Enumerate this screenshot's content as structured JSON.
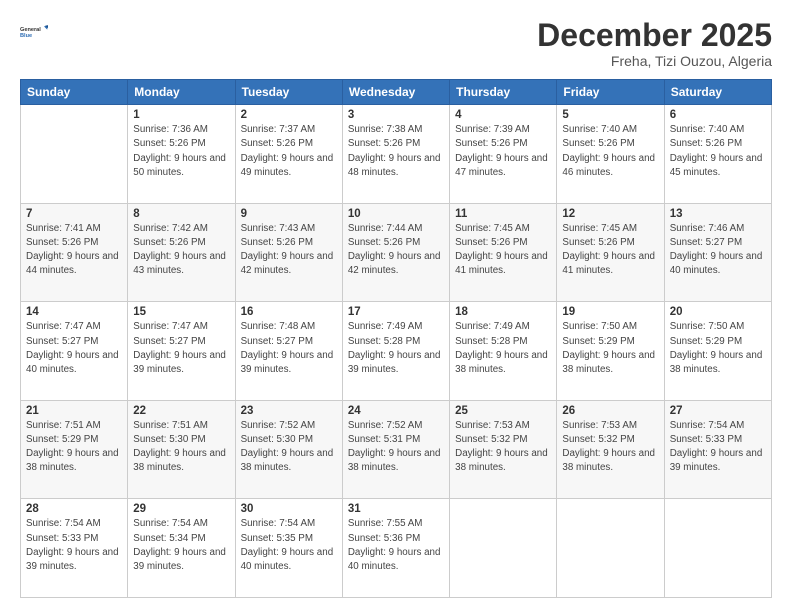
{
  "logo": {
    "line1": "General",
    "line2": "Blue"
  },
  "header": {
    "month": "December 2025",
    "location": "Freha, Tizi Ouzou, Algeria"
  },
  "weekdays": [
    "Sunday",
    "Monday",
    "Tuesday",
    "Wednesday",
    "Thursday",
    "Friday",
    "Saturday"
  ],
  "weeks": [
    [
      {
        "day": "",
        "sunrise": "",
        "sunset": "",
        "daylight": ""
      },
      {
        "day": "1",
        "sunrise": "Sunrise: 7:36 AM",
        "sunset": "Sunset: 5:26 PM",
        "daylight": "Daylight: 9 hours and 50 minutes."
      },
      {
        "day": "2",
        "sunrise": "Sunrise: 7:37 AM",
        "sunset": "Sunset: 5:26 PM",
        "daylight": "Daylight: 9 hours and 49 minutes."
      },
      {
        "day": "3",
        "sunrise": "Sunrise: 7:38 AM",
        "sunset": "Sunset: 5:26 PM",
        "daylight": "Daylight: 9 hours and 48 minutes."
      },
      {
        "day": "4",
        "sunrise": "Sunrise: 7:39 AM",
        "sunset": "Sunset: 5:26 PM",
        "daylight": "Daylight: 9 hours and 47 minutes."
      },
      {
        "day": "5",
        "sunrise": "Sunrise: 7:40 AM",
        "sunset": "Sunset: 5:26 PM",
        "daylight": "Daylight: 9 hours and 46 minutes."
      },
      {
        "day": "6",
        "sunrise": "Sunrise: 7:40 AM",
        "sunset": "Sunset: 5:26 PM",
        "daylight": "Daylight: 9 hours and 45 minutes."
      }
    ],
    [
      {
        "day": "7",
        "sunrise": "Sunrise: 7:41 AM",
        "sunset": "Sunset: 5:26 PM",
        "daylight": "Daylight: 9 hours and 44 minutes."
      },
      {
        "day": "8",
        "sunrise": "Sunrise: 7:42 AM",
        "sunset": "Sunset: 5:26 PM",
        "daylight": "Daylight: 9 hours and 43 minutes."
      },
      {
        "day": "9",
        "sunrise": "Sunrise: 7:43 AM",
        "sunset": "Sunset: 5:26 PM",
        "daylight": "Daylight: 9 hours and 42 minutes."
      },
      {
        "day": "10",
        "sunrise": "Sunrise: 7:44 AM",
        "sunset": "Sunset: 5:26 PM",
        "daylight": "Daylight: 9 hours and 42 minutes."
      },
      {
        "day": "11",
        "sunrise": "Sunrise: 7:45 AM",
        "sunset": "Sunset: 5:26 PM",
        "daylight": "Daylight: 9 hours and 41 minutes."
      },
      {
        "day": "12",
        "sunrise": "Sunrise: 7:45 AM",
        "sunset": "Sunset: 5:26 PM",
        "daylight": "Daylight: 9 hours and 41 minutes."
      },
      {
        "day": "13",
        "sunrise": "Sunrise: 7:46 AM",
        "sunset": "Sunset: 5:27 PM",
        "daylight": "Daylight: 9 hours and 40 minutes."
      }
    ],
    [
      {
        "day": "14",
        "sunrise": "Sunrise: 7:47 AM",
        "sunset": "Sunset: 5:27 PM",
        "daylight": "Daylight: 9 hours and 40 minutes."
      },
      {
        "day": "15",
        "sunrise": "Sunrise: 7:47 AM",
        "sunset": "Sunset: 5:27 PM",
        "daylight": "Daylight: 9 hours and 39 minutes."
      },
      {
        "day": "16",
        "sunrise": "Sunrise: 7:48 AM",
        "sunset": "Sunset: 5:27 PM",
        "daylight": "Daylight: 9 hours and 39 minutes."
      },
      {
        "day": "17",
        "sunrise": "Sunrise: 7:49 AM",
        "sunset": "Sunset: 5:28 PM",
        "daylight": "Daylight: 9 hours and 39 minutes."
      },
      {
        "day": "18",
        "sunrise": "Sunrise: 7:49 AM",
        "sunset": "Sunset: 5:28 PM",
        "daylight": "Daylight: 9 hours and 38 minutes."
      },
      {
        "day": "19",
        "sunrise": "Sunrise: 7:50 AM",
        "sunset": "Sunset: 5:29 PM",
        "daylight": "Daylight: 9 hours and 38 minutes."
      },
      {
        "day": "20",
        "sunrise": "Sunrise: 7:50 AM",
        "sunset": "Sunset: 5:29 PM",
        "daylight": "Daylight: 9 hours and 38 minutes."
      }
    ],
    [
      {
        "day": "21",
        "sunrise": "Sunrise: 7:51 AM",
        "sunset": "Sunset: 5:29 PM",
        "daylight": "Daylight: 9 hours and 38 minutes."
      },
      {
        "day": "22",
        "sunrise": "Sunrise: 7:51 AM",
        "sunset": "Sunset: 5:30 PM",
        "daylight": "Daylight: 9 hours and 38 minutes."
      },
      {
        "day": "23",
        "sunrise": "Sunrise: 7:52 AM",
        "sunset": "Sunset: 5:30 PM",
        "daylight": "Daylight: 9 hours and 38 minutes."
      },
      {
        "day": "24",
        "sunrise": "Sunrise: 7:52 AM",
        "sunset": "Sunset: 5:31 PM",
        "daylight": "Daylight: 9 hours and 38 minutes."
      },
      {
        "day": "25",
        "sunrise": "Sunrise: 7:53 AM",
        "sunset": "Sunset: 5:32 PM",
        "daylight": "Daylight: 9 hours and 38 minutes."
      },
      {
        "day": "26",
        "sunrise": "Sunrise: 7:53 AM",
        "sunset": "Sunset: 5:32 PM",
        "daylight": "Daylight: 9 hours and 38 minutes."
      },
      {
        "day": "27",
        "sunrise": "Sunrise: 7:54 AM",
        "sunset": "Sunset: 5:33 PM",
        "daylight": "Daylight: 9 hours and 39 minutes."
      }
    ],
    [
      {
        "day": "28",
        "sunrise": "Sunrise: 7:54 AM",
        "sunset": "Sunset: 5:33 PM",
        "daylight": "Daylight: 9 hours and 39 minutes."
      },
      {
        "day": "29",
        "sunrise": "Sunrise: 7:54 AM",
        "sunset": "Sunset: 5:34 PM",
        "daylight": "Daylight: 9 hours and 39 minutes."
      },
      {
        "day": "30",
        "sunrise": "Sunrise: 7:54 AM",
        "sunset": "Sunset: 5:35 PM",
        "daylight": "Daylight: 9 hours and 40 minutes."
      },
      {
        "day": "31",
        "sunrise": "Sunrise: 7:55 AM",
        "sunset": "Sunset: 5:36 PM",
        "daylight": "Daylight: 9 hours and 40 minutes."
      },
      {
        "day": "",
        "sunrise": "",
        "sunset": "",
        "daylight": ""
      },
      {
        "day": "",
        "sunrise": "",
        "sunset": "",
        "daylight": ""
      },
      {
        "day": "",
        "sunrise": "",
        "sunset": "",
        "daylight": ""
      }
    ]
  ]
}
